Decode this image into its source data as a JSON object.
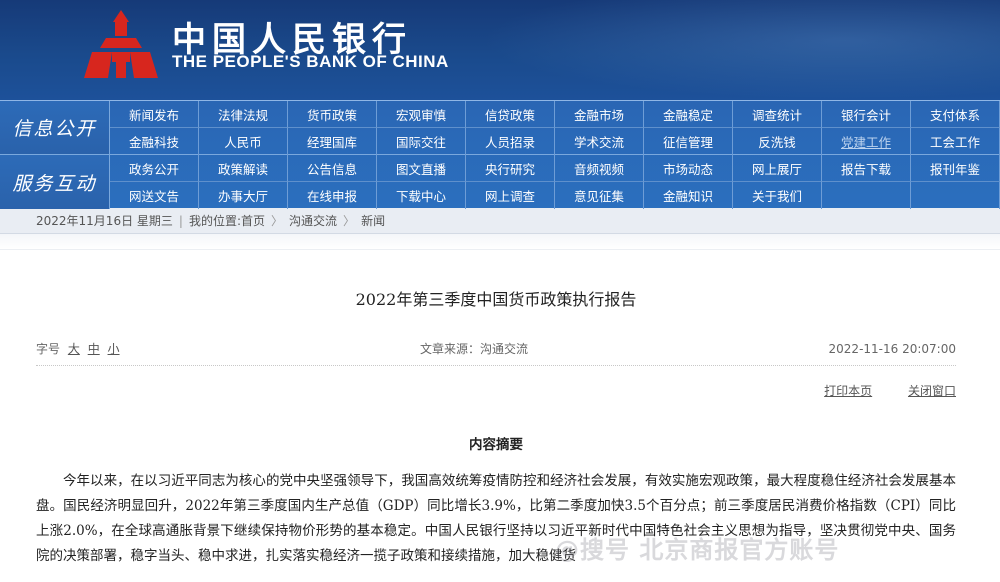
{
  "header": {
    "bank_name_cn": "中国人民银行",
    "bank_name_en": "THE PEOPLE'S BANK OF CHINA",
    "brand_color": "#1a4a8c",
    "logo_color": "#d7261e"
  },
  "nav": {
    "groups": [
      {
        "label": "信息公开",
        "items": [
          "新闻发布",
          "法律法规",
          "货币政策",
          "宏观审慎",
          "信贷政策",
          "金融市场",
          "金融稳定",
          "调查统计",
          "银行会计",
          "支付体系",
          "金融科技",
          "人民币",
          "经理国库",
          "国际交往",
          "人员招录",
          "学术交流",
          "征信管理",
          "反洗钱",
          "党建工作",
          "工会工作"
        ]
      },
      {
        "label": "服务互动",
        "items": [
          "政务公开",
          "政策解读",
          "公告信息",
          "图文直播",
          "央行研究",
          "音频视频",
          "市场动态",
          "网上展厅",
          "报告下载",
          "报刊年鉴",
          "网送文告",
          "办事大厅",
          "在线申报",
          "下载中心",
          "网上调查",
          "意见征集",
          "金融知识",
          "关于我们",
          "",
          ""
        ]
      }
    ]
  },
  "breadcrumb": {
    "date": "2022年11月16日 星期三",
    "location_label": "我的位置:",
    "home": "首页",
    "level1": "沟通交流",
    "level2": "新闻"
  },
  "article": {
    "title": "2022年第三季度中国货币政策执行报告",
    "font_label": "字号",
    "font_large": "大",
    "font_medium": "中",
    "font_small": "小",
    "source": "文章来源：沟通交流",
    "datetime": "2022-11-16 20:07:00",
    "print": "打印本页",
    "close": "关闭窗口",
    "subheading": "内容摘要",
    "paragraph": "今年以来，在以习近平同志为核心的党中央坚强领导下，我国高效统筹疫情防控和经济社会发展，有效实施宏观政策，最大程度稳住经济社会发展基本盘。国民经济明显回升，2022年第三季度国内生产总值（GDP）同比增长3.9%，比第二季度加快3.5个百分点；前三季度居民消费价格指数（CPI）同比上涨2.0%，在全球高通胀背景下继续保持物价形势的基本稳定。中国人民银行坚持以习近平新时代中国特色社会主义思想为指导，坚决贯彻党中央、国务院的决策部署，稳字当头、稳中求进，扎实落实稳经济一揽子政策和接续措施，加大稳健货"
  },
  "watermark": "@搜号 北京商报官方账号"
}
